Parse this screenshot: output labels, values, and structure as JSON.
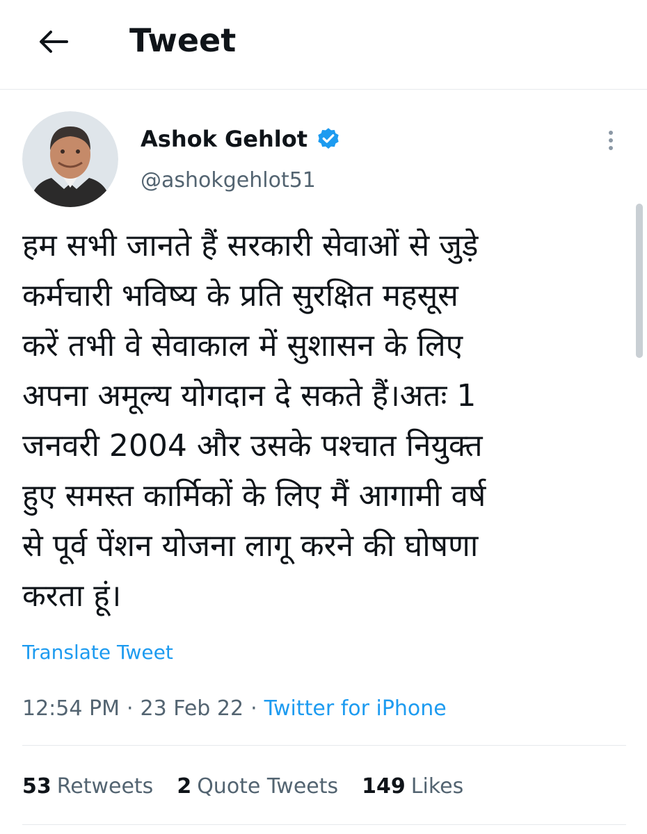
{
  "header": {
    "title": "Tweet",
    "back_icon": "arrow-left-icon"
  },
  "author": {
    "display_name": "Ashok Gehlot",
    "handle": "@ashokgehlot51",
    "verified": true,
    "verified_color": "#1d9bf0"
  },
  "tweet": {
    "text": "हम सभी जानते हैं सरकारी सेवाओं से जुड़े\nकर्मचारी भविष्य के प्रति सुरक्षित महसूस\nकरें तभी वे सेवाकाल में सुशासन के लिए\nअपना अमूल्य योगदान दे सकते हैं।अतः 1\nजनवरी 2004 और उसके पश्चात नियुक्त\nहुए समस्त कार्मिकों के लिए मैं आगामी वर्ष\nसे पूर्व पेंशन योजना लागू करने की घोषणा\nकरता हूं।",
    "translate_label": "Translate Tweet",
    "time": "12:54 PM",
    "separator": "·",
    "date": "23 Feb 22",
    "source": "Twitter for iPhone"
  },
  "stats": {
    "retweets_count": "53",
    "retweets_label": "Retweets",
    "quotes_count": "2",
    "quotes_label": "Quote Tweets",
    "likes_count": "149",
    "likes_label": "Likes"
  },
  "colors": {
    "accent": "#1d9bf0",
    "text": "#0f1419",
    "secondary": "#536471",
    "divider": "#e6e9ec"
  }
}
